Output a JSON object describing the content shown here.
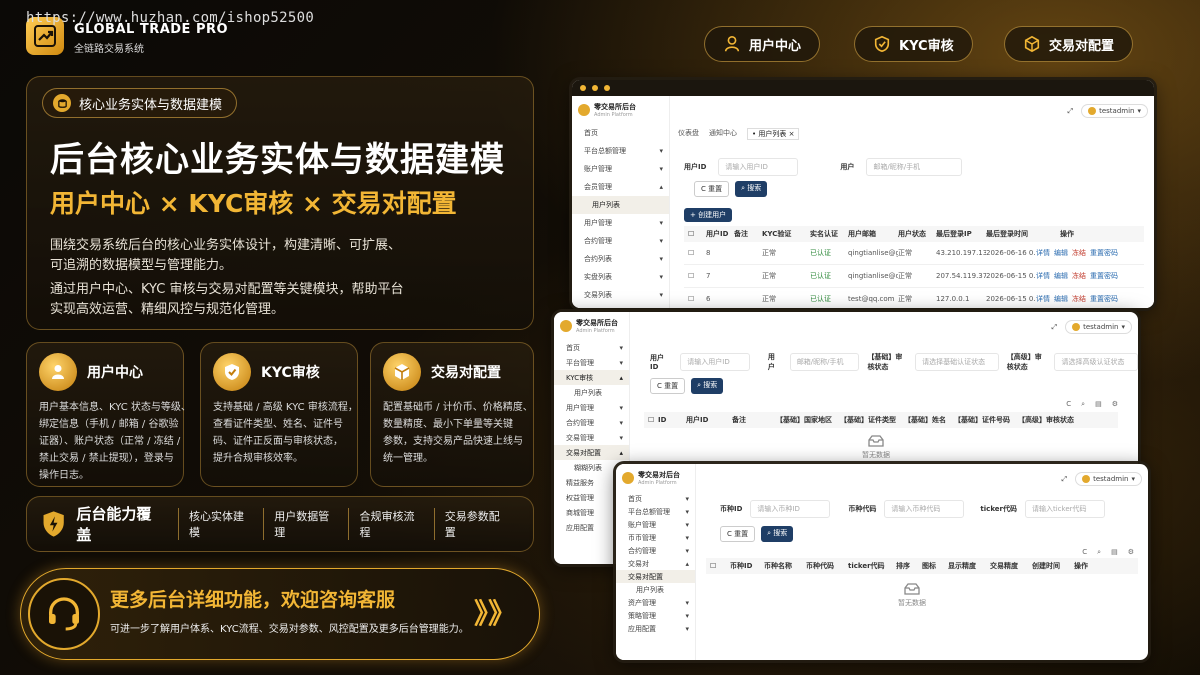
{
  "watermark": "https://www.huzhan.com/ishop52500",
  "brand": {
    "title": "GLOBAL TRADE PRO",
    "subtitle": "全链路交易系统"
  },
  "top_buttons": [
    {
      "label": "用户中心",
      "icon": "user-icon"
    },
    {
      "label": "KYC审核",
      "icon": "shield-check-icon"
    },
    {
      "label": "交易对配置",
      "icon": "cube-icon"
    }
  ],
  "hero": {
    "chip": "核心业务实体与数据建模",
    "title": "后台核心业务实体与数据建模",
    "subtitle": "用户中心 × KYC审核 × 交易对配置",
    "desc": [
      "围绕交易系统后台的核心业务实体设计，构建清晰、可扩展、",
      "可追溯的数据模型与管理能力。",
      "通过用户中心、KYC 审核与交易对配置等关键模块，帮助平台",
      "实现高效运营、精细风控与规范化管理。"
    ]
  },
  "cards": [
    {
      "title": "用户中心",
      "icon": "user-icon",
      "lines": [
        "用户基本信息、KYC 状态与等级、",
        "绑定信息（手机 / 邮箱 / 谷歌验",
        "证器）、账户状态（正常 / 冻结 /",
        "禁止交易 / 禁止提现），登录与",
        "操作日志。"
      ]
    },
    {
      "title": "KYC审核",
      "icon": "shield-check-icon",
      "lines": [
        "支持基础 / 高级 KYC 审核流程，",
        "查看证件类型、姓名、证件号",
        "码、证件正反面与审核状态，",
        "提升合规审核效率。"
      ]
    },
    {
      "title": "交易对配置",
      "icon": "cube-icon",
      "lines": [
        "配置基础币 / 计价币、价格精度、",
        "数量精度、最小下单量等关键",
        "参数，支持交易产品快速上线与",
        "统一管理。"
      ]
    }
  ],
  "capability": {
    "title": "后台能力覆盖",
    "items": [
      "核心实体建模",
      "用户数据管理",
      "合规审核流程",
      "交易参数配置"
    ]
  },
  "cta": {
    "title": "更多后台详细功能，欢迎咨询客服",
    "sub": "可进一步了解用户体系、KYC流程、交易对参数、风控配置及更多后台管理能力。",
    "arrows": "》》"
  },
  "win1": {
    "brand": "零交易所后台",
    "brand_sub": "Admin Platform",
    "user": "testadmin",
    "tabs": [
      "仪表盘",
      "通知中心",
      "用户列表"
    ],
    "menu": [
      "首页",
      "平台总额管理",
      "账户管理",
      "会员管理",
      "用户列表",
      "用户管理",
      "合约管理",
      "合约列表",
      "实盘列表",
      "交易列表"
    ],
    "filters": [
      {
        "label": "用户ID",
        "placeholder": "请输入用户ID"
      },
      {
        "label": "用户",
        "placeholder": "邮箱/昵称/手机"
      }
    ],
    "btn_reset": "重置",
    "btn_search": "搜索",
    "btn_create": "+ 创建用户",
    "columns": [
      "用户ID",
      "备注",
      "KYC验证",
      "实名认证",
      "用户邮箱",
      "用户状态",
      "最后登录IP",
      "最后登录时间",
      "操作"
    ],
    "rows": [
      {
        "id": "8",
        "kyc": "正常",
        "auth": "已认证",
        "email": "qingtianlise@g...",
        "status": "正常",
        "ip": "43.210.197.133",
        "time": "2026-06-16 0..."
      },
      {
        "id": "7",
        "kyc": "正常",
        "auth": "已认证",
        "email": "qingtianlise@out...",
        "status": "正常",
        "ip": "207.54.119.37",
        "time": "2026-06-15 0..."
      },
      {
        "id": "6",
        "kyc": "正常",
        "auth": "已认证",
        "email": "test@qq.com",
        "status": "正常",
        "ip": "127.0.0.1",
        "time": "2026-06-15 0..."
      }
    ],
    "ops": [
      "详情",
      "编辑",
      "冻结",
      "重置密码"
    ]
  },
  "win2": {
    "brand": "零交易所后台",
    "brand_sub": "Admin Platform",
    "user": "testadmin",
    "menu": [
      "首页",
      "平台管理",
      "KYC审核",
      "用户列表",
      "用户管理",
      "合约管理",
      "交易管理",
      "交易对配置",
      "糊糊列表",
      "精益服务",
      "权益管理",
      "商城管理",
      "应用配置"
    ],
    "filters": [
      {
        "label": "用户ID",
        "placeholder": "请输入用户ID"
      },
      {
        "label": "用户",
        "placeholder": "邮箱/昵称/手机"
      },
      {
        "label": "【基础】审核状态",
        "placeholder": "请选择基础认证状态"
      },
      {
        "label": "【高级】审核状态",
        "placeholder": "请选择高级认证状态"
      }
    ],
    "btn_reset": "重置",
    "btn_search": "搜索",
    "columns": [
      "ID",
      "用户ID",
      "备注",
      "【基础】国家地区",
      "【基础】证件类型",
      "【基础】姓名",
      "【基础】证件号码",
      "【高级】审核状态"
    ],
    "empty": "暂无数据"
  },
  "win3": {
    "brand": "零交易对后台",
    "brand_sub": "Admin Platform",
    "user": "testadmin",
    "menu": [
      "首页",
      "平台总额管理",
      "账户管理",
      "币币管理",
      "合约管理",
      "交易对",
      "交易对配置",
      "用户列表",
      "资产管理",
      "策略管理",
      "应用配置"
    ],
    "filters": [
      {
        "label": "币种ID",
        "placeholder": "请输入币种ID"
      },
      {
        "label": "币种代码",
        "placeholder": "请输入币种代码"
      },
      {
        "label": "ticker代码",
        "placeholder": "请输入ticker代码"
      }
    ],
    "btn_reset": "重置",
    "btn_search": "搜索",
    "columns": [
      "币种ID",
      "币种名称",
      "币种代码",
      "ticker代码",
      "排序",
      "图标",
      "显示精度",
      "交易精度",
      "创建时间",
      "操作"
    ],
    "empty": "暂无数据"
  }
}
